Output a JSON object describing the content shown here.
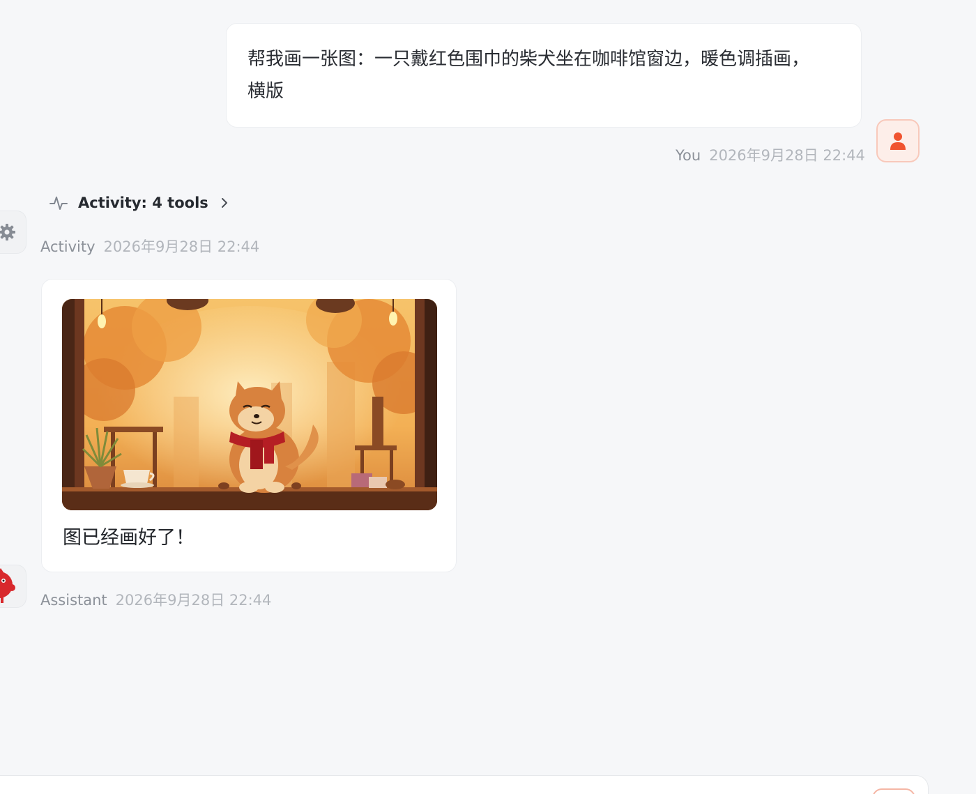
{
  "user_message": {
    "text": "帮我画一张图：一只戴红色围巾的柴犬坐在咖啡馆窗边，暖色调插画，横版",
    "sender": "You",
    "timestamp": "2026年9月28日 22:44"
  },
  "activity": {
    "label": "Activity: 4 tools",
    "sender": "Activity",
    "timestamp": "2026年9月28日 22:44"
  },
  "assistant_message": {
    "text": "图已经画好了！",
    "sender": "Assistant",
    "timestamp": "2026年9月28日 22:44"
  },
  "icons": {
    "user_avatar": "person-icon",
    "activity": "pulse-icon",
    "expand": "chevron-right-icon",
    "activity_avatar": "gear-icon",
    "assistant_avatar": "red-mascot-icon"
  },
  "colors": {
    "accent": "#f0532f",
    "background": "#f6f7f9",
    "bubble": "#ffffff"
  }
}
